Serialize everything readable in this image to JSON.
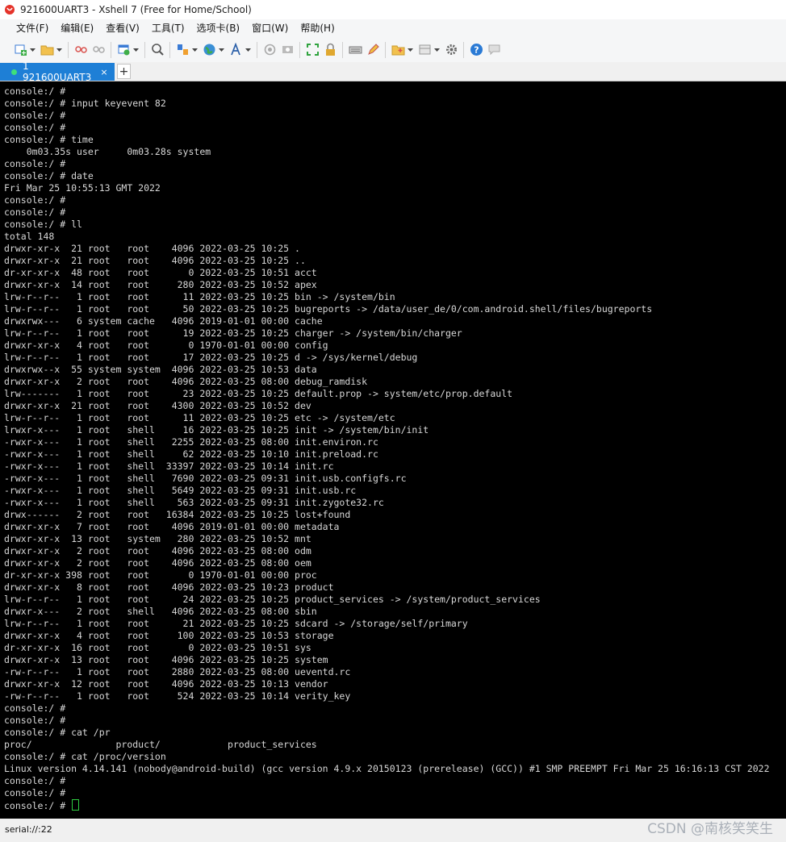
{
  "window": {
    "title": "921600UART3 - Xshell 7 (Free for Home/School)"
  },
  "menubar": {
    "items": [
      "文件(F)",
      "编辑(E)",
      "查看(V)",
      "工具(T)",
      "选项卡(B)",
      "窗口(W)",
      "帮助(H)"
    ]
  },
  "tabs": {
    "active_label": "1 921600UART3",
    "close_glyph": "×",
    "add_glyph": "+"
  },
  "terminal": {
    "lines": [
      "console:/ #",
      "console:/ # input keyevent 82",
      "console:/ #",
      "console:/ #",
      "console:/ # time",
      "    0m03.35s user     0m03.28s system",
      "console:/ #",
      "console:/ # date",
      "Fri Mar 25 10:55:13 GMT 2022",
      "console:/ #",
      "console:/ #",
      "console:/ # ll",
      "total 148",
      "drwxr-xr-x  21 root   root    4096 2022-03-25 10:25 .",
      "drwxr-xr-x  21 root   root    4096 2022-03-25 10:25 ..",
      "dr-xr-xr-x  48 root   root       0 2022-03-25 10:51 acct",
      "drwxr-xr-x  14 root   root     280 2022-03-25 10:52 apex",
      "lrw-r--r--   1 root   root      11 2022-03-25 10:25 bin -> /system/bin",
      "lrw-r--r--   1 root   root      50 2022-03-25 10:25 bugreports -> /data/user_de/0/com.android.shell/files/bugreports",
      "drwxrwx---   6 system cache   4096 2019-01-01 00:00 cache",
      "lrw-r--r--   1 root   root      19 2022-03-25 10:25 charger -> /system/bin/charger",
      "drwxr-xr-x   4 root   root       0 1970-01-01 00:00 config",
      "lrw-r--r--   1 root   root      17 2022-03-25 10:25 d -> /sys/kernel/debug",
      "drwxrwx--x  55 system system  4096 2022-03-25 10:53 data",
      "drwxr-xr-x   2 root   root    4096 2022-03-25 08:00 debug_ramdisk",
      "lrw-------   1 root   root      23 2022-03-25 10:25 default.prop -> system/etc/prop.default",
      "drwxr-xr-x  21 root   root    4300 2022-03-25 10:52 dev",
      "lrw-r--r--   1 root   root      11 2022-03-25 10:25 etc -> /system/etc",
      "lrwxr-x---   1 root   shell     16 2022-03-25 10:25 init -> /system/bin/init",
      "-rwxr-x---   1 root   shell   2255 2022-03-25 08:00 init.environ.rc",
      "-rwxr-x---   1 root   shell     62 2022-03-25 10:10 init.preload.rc",
      "-rwxr-x---   1 root   shell  33397 2022-03-25 10:14 init.rc",
      "-rwxr-x---   1 root   shell   7690 2022-03-25 09:31 init.usb.configfs.rc",
      "-rwxr-x---   1 root   shell   5649 2022-03-25 09:31 init.usb.rc",
      "-rwxr-x---   1 root   shell    563 2022-03-25 09:31 init.zygote32.rc",
      "drwx------   2 root   root   16384 2022-03-25 10:25 lost+found",
      "drwxr-xr-x   7 root   root    4096 2019-01-01 00:00 metadata",
      "drwxr-xr-x  13 root   system   280 2022-03-25 10:52 mnt",
      "drwxr-xr-x   2 root   root    4096 2022-03-25 08:00 odm",
      "drwxr-xr-x   2 root   root    4096 2022-03-25 08:00 oem",
      "dr-xr-xr-x 398 root   root       0 1970-01-01 00:00 proc",
      "drwxr-xr-x   8 root   root    4096 2022-03-25 10:23 product",
      "lrw-r--r--   1 root   root      24 2022-03-25 10:25 product_services -> /system/product_services",
      "drwxr-x---   2 root   shell   4096 2022-03-25 08:00 sbin",
      "lrw-r--r--   1 root   root      21 2022-03-25 10:25 sdcard -> /storage/self/primary",
      "drwxr-xr-x   4 root   root     100 2022-03-25 10:53 storage",
      "dr-xr-xr-x  16 root   root       0 2022-03-25 10:51 sys",
      "drwxr-xr-x  13 root   root    4096 2022-03-25 10:25 system",
      "-rw-r--r--   1 root   root    2880 2022-03-25 08:00 ueventd.rc",
      "drwxr-xr-x  12 root   root    4096 2022-03-25 10:13 vendor",
      "-rw-r--r--   1 root   root     524 2022-03-25 10:14 verity_key",
      "console:/ #",
      "console:/ #",
      "console:/ # cat /pr",
      "proc/               product/            product_services",
      "console:/ # cat /proc/version",
      "Linux version 4.14.141 (nobody@android-build) (gcc version 4.9.x 20150123 (prerelease) (GCC)) #1 SMP PREEMPT Fri Mar 25 16:16:13 CST 2022",
      "console:/ #",
      "console:/ #",
      "console:/ #"
    ]
  },
  "statusbar": {
    "connection": "serial://:22"
  },
  "watermark": {
    "text": "CSDN @南核笑笑生"
  },
  "colors": {
    "tab_active": "#1e7fd6",
    "terminal_bg": "#000000",
    "terminal_fg": "#d8d8d8",
    "cursor": "#2ecc40"
  },
  "toolbar_icons": [
    "new-session-icon",
    "open-folder-icon",
    "connect-icon",
    "disconnect-icon",
    "new-tab-icon",
    "search-icon",
    "transfer-icon",
    "globe-icon",
    "font-icon",
    "record-icon",
    "screenshot-icon",
    "fullscreen-icon",
    "lock-icon",
    "keyboard-icon",
    "highlight-icon",
    "new-folder-icon",
    "layout-icon",
    "settings-icon",
    "help-icon",
    "chat-icon"
  ]
}
